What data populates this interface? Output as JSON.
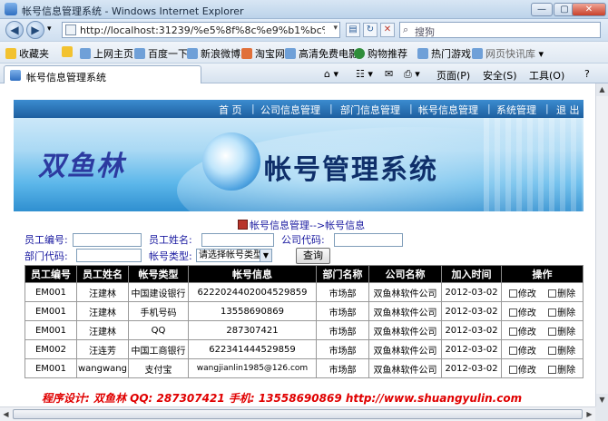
{
  "window": {
    "title": "帐号信息管理系统 - Windows Internet Explorer",
    "minimize": "—",
    "maximize": "▢",
    "close": "✕"
  },
  "address_bar": {
    "back": "◀",
    "forward": "▶",
    "url": "http://localhost:31239/%e5%8f%8c%e9%b1%bc%e6%9e%97",
    "refresh": "↻",
    "stop": "✕",
    "search_placeholder": "搜狗"
  },
  "favorites": {
    "label": "收藏夹",
    "items": [
      "上网主页",
      "百度一下",
      "新浪微博",
      "淘宝网",
      "高清免费电影",
      "购物推荐",
      "热门游戏",
      "网页快讯库"
    ]
  },
  "tab": {
    "label": "帐号信息管理系统"
  },
  "commands": {
    "page": "页面(P)",
    "safety": "安全(S)",
    "tools": "工具(O)",
    "help": "?"
  },
  "site_nav": [
    "首 页",
    "公司信息管理",
    "部门信息管理",
    "帐号信息管理",
    "系统管理",
    "退 出"
  ],
  "banner": {
    "brand": "双鱼林",
    "system_name": "帐号管理系统"
  },
  "breadcrumb": "帐号信息管理-->帐号信息",
  "filters": {
    "emp_no_label": "员工编号:",
    "emp_name_label": "员工姓名:",
    "company_code_label": "公司代码:",
    "dept_code_label": "部门代码:",
    "account_type_label": "帐号类型:",
    "account_type_value": "请选择帐号类型",
    "query_button": "查询"
  },
  "table": {
    "columns": [
      "员工编号",
      "员工姓名",
      "帐号类型",
      "帐号信息",
      "部门名称",
      "公司名称",
      "加入时间",
      "操作"
    ],
    "edit_label": "修改",
    "delete_label": "删除",
    "rows": [
      {
        "emp_no": "EM001",
        "name": "汪建林",
        "type": "中国建设银行",
        "info": "6222024402004529859",
        "dept": "市场部",
        "company": "双鱼林软件公司",
        "date": "2012-03-02"
      },
      {
        "emp_no": "EM001",
        "name": "汪建林",
        "type": "手机号码",
        "info": "13558690869",
        "dept": "市场部",
        "company": "双鱼林软件公司",
        "date": "2012-03-02"
      },
      {
        "emp_no": "EM001",
        "name": "汪建林",
        "type": "QQ",
        "info": "287307421",
        "dept": "市场部",
        "company": "双鱼林软件公司",
        "date": "2012-03-02"
      },
      {
        "emp_no": "EM002",
        "name": "汪连芳",
        "type": "中国工商银行",
        "info": "622341444529859",
        "dept": "市场部",
        "company": "双鱼林软件公司",
        "date": "2012-03-02"
      },
      {
        "emp_no": "EM001",
        "name": "wangwang",
        "type": "支付宝",
        "info": "wangjianlin1985@126.com",
        "dept": "市场部",
        "company": "双鱼林软件公司",
        "date": "2012-03-02"
      }
    ]
  },
  "footer": "程序设计: 双鱼林   QQ: 287307421   手机: 13558690869   http://www.shuangyulin.com",
  "colors": {
    "nav_blue": "#1d5f9f",
    "label_blue": "#1a1aa0",
    "footer_red": "#e00000",
    "header_black": "#000000"
  }
}
